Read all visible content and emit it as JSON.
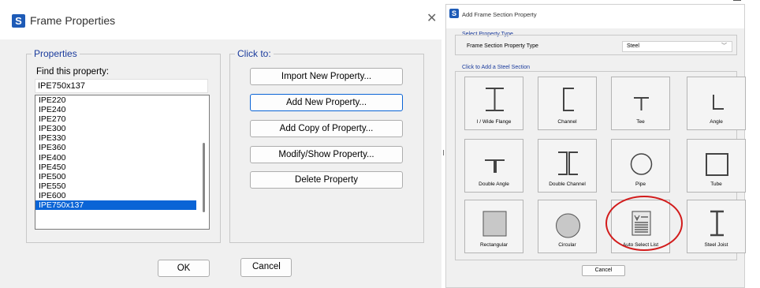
{
  "frame_properties": {
    "title": "Frame Properties",
    "app_badge": "S",
    "close_glyph": "✕",
    "properties_group": "Properties",
    "find_label": "Find this property:",
    "find_value": "IPE750x137",
    "list": [
      "IPE220",
      "IPE240",
      "IPE270",
      "IPE300",
      "IPE330",
      "IPE360",
      "IPE400",
      "IPE450",
      "IPE500",
      "IPE550",
      "IPE600",
      "IPE750x137"
    ],
    "selected_item": "IPE750x137",
    "click_to_group": "Click to:",
    "buttons": {
      "import": "Import New Property...",
      "add_new": "Add New Property...",
      "add_copy": "Add Copy of Property...",
      "modify": "Modify/Show Property...",
      "delete": "Delete Property"
    },
    "ok": "OK",
    "cancel": "Cancel"
  },
  "add_section": {
    "title": "Add Frame Section Property",
    "app_badge": "S",
    "select_type_label": "Select Property Type",
    "type_field_label": "Frame Section Property Type",
    "type_value": "Steel",
    "click_to_add_label": "Click to Add a Steel Section",
    "tiles": [
      {
        "label": "I / Wide Flange",
        "icon": "i-beam-icon"
      },
      {
        "label": "Channel",
        "icon": "channel-icon"
      },
      {
        "label": "Tee",
        "icon": "tee-icon"
      },
      {
        "label": "Angle",
        "icon": "angle-icon"
      },
      {
        "label": "Double Angle",
        "icon": "double-angle-icon"
      },
      {
        "label": "Double Channel",
        "icon": "double-channel-icon"
      },
      {
        "label": "Pipe",
        "icon": "pipe-icon"
      },
      {
        "label": "Tube",
        "icon": "tube-icon"
      },
      {
        "label": "Rectangular",
        "icon": "rectangular-icon"
      },
      {
        "label": "Circular",
        "icon": "circular-icon"
      },
      {
        "label": "Auto Select List",
        "icon": "auto-select-list-icon"
      },
      {
        "label": "Steel Joist",
        "icon": "steel-joist-icon"
      }
    ],
    "highlighted_tile": "Auto Select List",
    "highlight_color": "#d21b1b",
    "cancel": "Cancel"
  },
  "colors": {
    "selection": "#0a64d6",
    "group_label": "#1a3b9c",
    "app_badge": "#1e5bb7"
  }
}
